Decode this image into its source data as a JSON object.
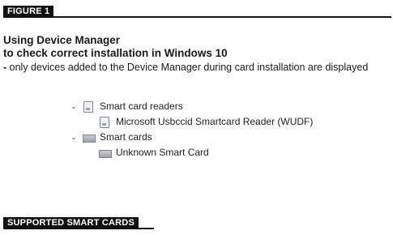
{
  "figure_label": "FIGURE 1",
  "heading": {
    "line1": "Using Device Manager",
    "line2": "to check correct installation in Windows 10"
  },
  "note": {
    "dash": "-",
    "text": " only devices added to the Device Manager during card installation are displayed"
  },
  "tree": {
    "readers": {
      "label": "Smart card readers",
      "icon": "card-reader-icon",
      "children": [
        {
          "label": "Microsoft Usbccid Smartcard Reader (WUDF)",
          "icon": "card-reader-icon"
        }
      ]
    },
    "cards": {
      "label": "Smart cards",
      "icon": "smart-card-icon",
      "children": [
        {
          "label": "Unknown Smart Card",
          "icon": "smart-card-icon"
        }
      ]
    },
    "expand_glyph": "⌄"
  },
  "section2_label": "SUPPORTED SMART CARDS"
}
